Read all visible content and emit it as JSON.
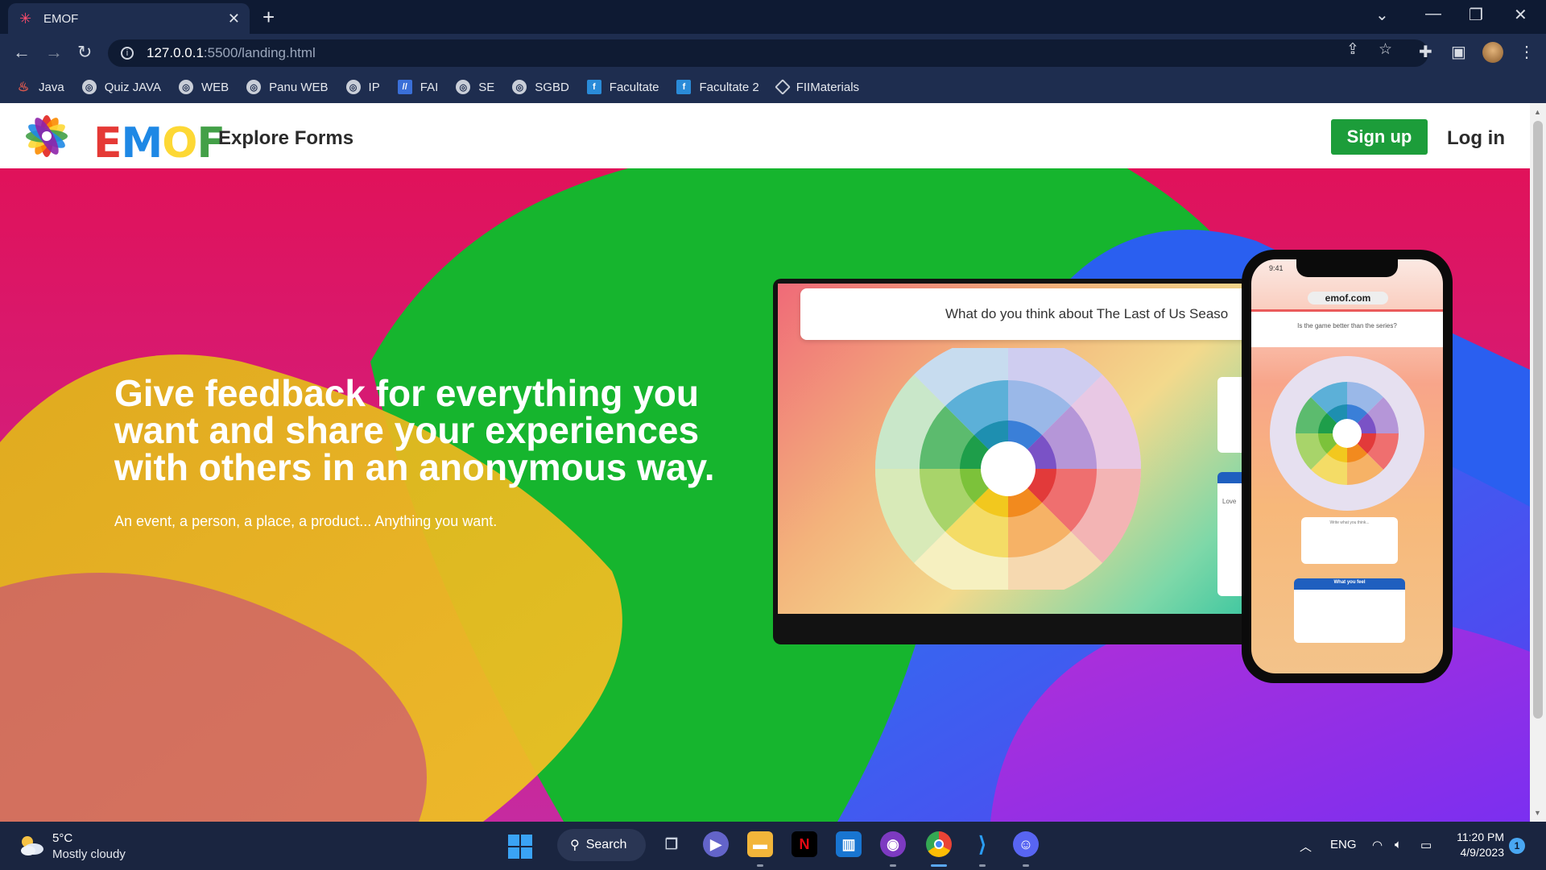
{
  "browser": {
    "tab_title": "EMOF",
    "url_host": "127.0.0.1",
    "url_path": ":5500/landing.html",
    "bookmarks": [
      {
        "label": "Java",
        "icon": "java-icon"
      },
      {
        "label": "Quiz JAVA",
        "icon": "globe-icon"
      },
      {
        "label": "WEB",
        "icon": "globe-icon"
      },
      {
        "label": "Panu WEB",
        "icon": "globe-icon"
      },
      {
        "label": "IP",
        "icon": "globe-icon"
      },
      {
        "label": "FAI",
        "icon": "fai-icon"
      },
      {
        "label": "SE",
        "icon": "globe-icon"
      },
      {
        "label": "SGBD",
        "icon": "globe-icon"
      },
      {
        "label": "Facultate",
        "icon": "fii-icon"
      },
      {
        "label": "Facultate 2",
        "icon": "fii-icon"
      },
      {
        "label": "FIIMaterials",
        "icon": "diamond-icon"
      }
    ]
  },
  "site": {
    "logo_text": "EMOF",
    "nav_explore": "Explore Forms",
    "signup": "Sign up",
    "login": "Log in",
    "hero_title": "Give feedback for everything you want and share your experiences with others in an anonymous way.",
    "hero_subtitle": "An event, a person, a place, a product... Anything you want.",
    "laptop_question": "What do you think about The Last of Us Seaso",
    "laptop_side_label": "Love",
    "phone_time": "9:41",
    "phone_url": "emof.com",
    "phone_question": "Is the game better than the series?",
    "phone_textarea": "Write what you think...",
    "phone_card_title": "What you feel"
  },
  "colors": {
    "accent_green": "#1c9d3a",
    "hero_bg": "#e0124f"
  },
  "taskbar": {
    "temperature": "5°C",
    "condition": "Mostly cloudy",
    "search_label": "Search",
    "language": "ENG",
    "time": "11:20 PM",
    "date": "4/9/2023",
    "notification_count": "1"
  }
}
